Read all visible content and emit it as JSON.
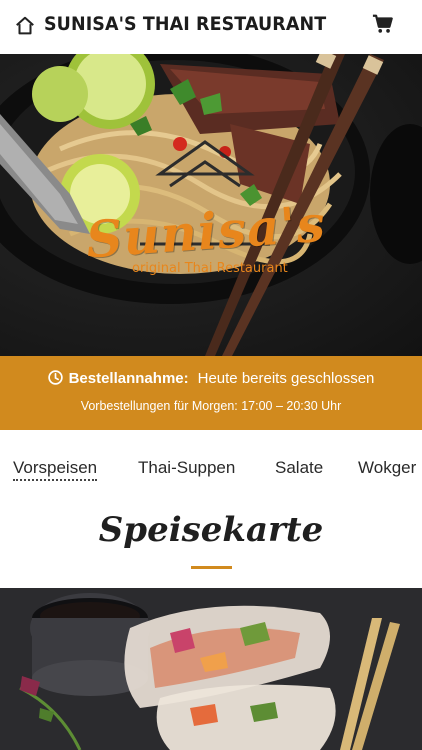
{
  "header": {
    "title": "SUNISA'S THAI RESTAURANT",
    "home_icon": "home-icon",
    "cart_icon": "cart-icon"
  },
  "hero": {
    "logo_text": "Sunisa's",
    "logo_subtitle": "original Thai Restaurant"
  },
  "banner": {
    "label": "Bestellannahme:",
    "status": "Heute bereits geschlossen",
    "preorder": "Vorbestellungen für Morgen: 17:00 – 20:30 Uhr",
    "icon": "clock-icon",
    "background": "#d18a1e"
  },
  "categories": {
    "items": [
      {
        "label": "Vorspeisen",
        "active": true
      },
      {
        "label": "Thai-Suppen",
        "active": false
      },
      {
        "label": "Salate",
        "active": false
      },
      {
        "label": "Wokger",
        "active": false
      }
    ]
  },
  "menu": {
    "heading": "Speisekarte",
    "accent": "#d18a1e"
  }
}
